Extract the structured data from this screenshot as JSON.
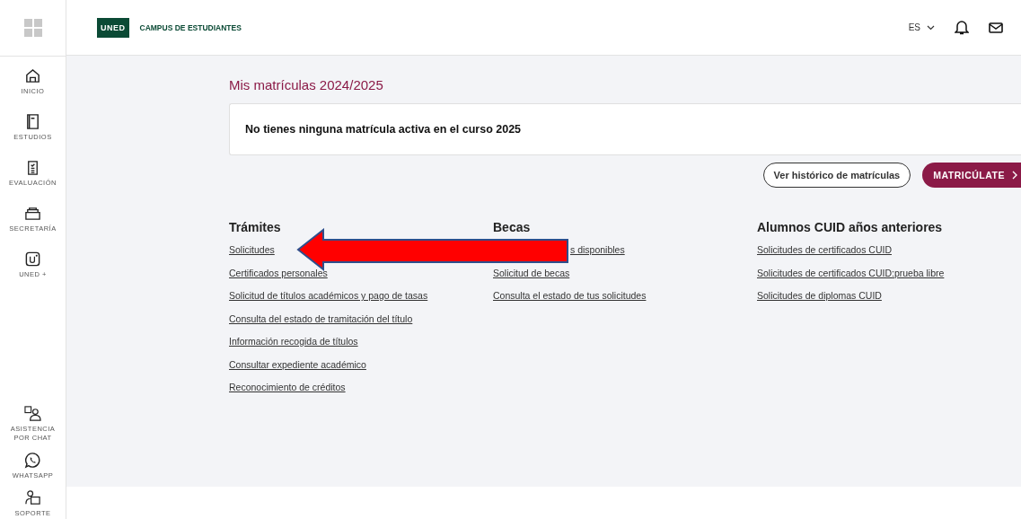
{
  "header": {
    "logo": "UNED",
    "title": "CAMPUS DE ESTUDIANTES",
    "language": "ES"
  },
  "sidebar": {
    "items": [
      {
        "label": "INICIO",
        "kind": "home"
      },
      {
        "label": "ESTUDIOS",
        "kind": "book"
      },
      {
        "label": "EVALUACIÓN",
        "kind": "clipboard"
      },
      {
        "label": "SECRETARÍA",
        "kind": "tray"
      },
      {
        "label": "UNED +",
        "kind": "uplus"
      }
    ],
    "bottom_items": [
      {
        "label": "ASISTENCIA POR CHAT",
        "kind": "chat"
      },
      {
        "label": "WHATSAPP",
        "kind": "whatsapp"
      },
      {
        "label": "SOPORTE",
        "kind": "support"
      }
    ]
  },
  "enrollment": {
    "title": "Mis matrículas 2024/2025",
    "message": "No tienes ninguna matrícula activa en el curso 2025",
    "history_button": "Ver histórico de matrículas",
    "enroll_button": "MATRICÚLATE"
  },
  "sections": [
    {
      "title": "Trámites",
      "links": [
        {
          "label": "Solicitudes",
          "kind": "plain"
        },
        {
          "label": "Certificados personales",
          "kind": "plain"
        },
        {
          "label": "Solicitud de títulos académicos y pago de tasas",
          "kind": "plain"
        },
        {
          "label": "Consulta del estado de tramitación del título",
          "kind": "plain"
        },
        {
          "label": "Información recogida de títulos",
          "kind": "plain"
        },
        {
          "label": "Consultar expediente académico",
          "kind": "plain"
        },
        {
          "label": "Reconocimiento de créditos",
          "kind": "plain"
        }
      ]
    },
    {
      "title": "Becas",
      "links": [
        {
          "label": "s disponibles",
          "kind": "under_arrow"
        },
        {
          "label": "Solicitud de becas",
          "kind": "plain"
        },
        {
          "label": "Consulta el estado de tus solicitudes",
          "kind": "plain"
        }
      ]
    },
    {
      "title": "Alumnos CUID años anteriores",
      "links": [
        {
          "label": "Solicitudes de certificados CUID",
          "kind": "plain"
        },
        {
          "label": "Solicitudes de certificados CUID:prueba libre",
          "kind": "plain"
        },
        {
          "label": "Solicitudes de diplomas CUID",
          "kind": "plain"
        }
      ]
    }
  ]
}
